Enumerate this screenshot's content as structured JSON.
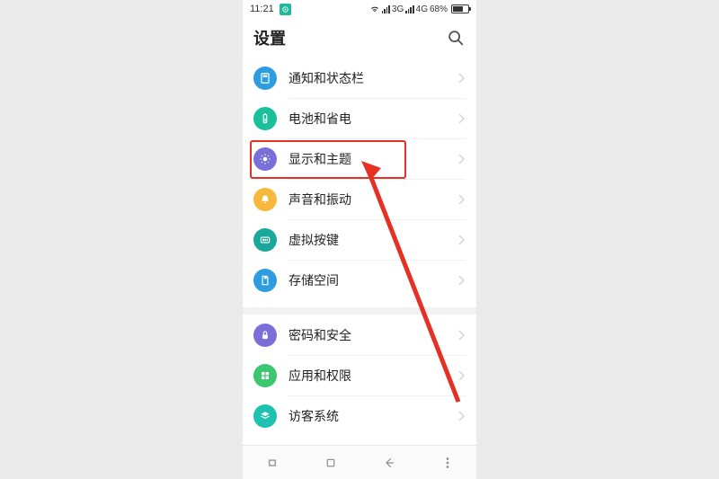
{
  "status": {
    "time": "11:21",
    "signal3g": "3G",
    "signal4g": "4G",
    "battery_pct": "68%"
  },
  "header": {
    "title": "设置"
  },
  "rows": {
    "r0": {
      "label": "通知和状态栏",
      "color": "#2e9de0"
    },
    "r1": {
      "label": "电池和省电",
      "color": "#19c19a"
    },
    "r2": {
      "label": "显示和主题",
      "color": "#7a6ed8"
    },
    "r3": {
      "label": "声音和振动",
      "color": "#f6b93b"
    },
    "r4": {
      "label": "虚拟按键",
      "color": "#1aa89a"
    },
    "r5": {
      "label": "存储空间",
      "color": "#2e9de0"
    },
    "r6": {
      "label": "密码和安全",
      "color": "#7a6ed8"
    },
    "r7": {
      "label": "应用和权限",
      "color": "#3bc670"
    },
    "r8": {
      "label": "访客系统",
      "color": "#1fc1b1"
    }
  }
}
